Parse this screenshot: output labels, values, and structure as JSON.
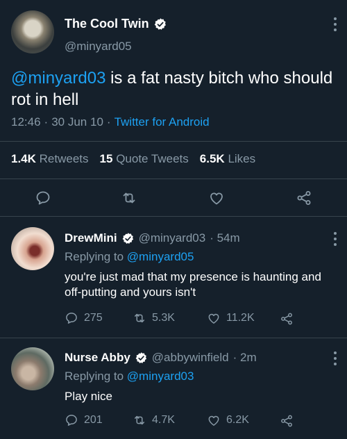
{
  "main_tweet": {
    "display_name": "The Cool Twin",
    "handle": "@minyard05",
    "mention": "@minyard03",
    "text": " is a fat nasty bitch who should rot in hell",
    "time": "12:46",
    "date": "30 Jun 10",
    "source": "Twitter for Android",
    "sep": "·",
    "stats": {
      "retweets_count": "1.4K",
      "retweets_label": "Retweets",
      "quotes_count": "15",
      "quotes_label": "Quote Tweets",
      "likes_count": "6.5K",
      "likes_label": "Likes"
    }
  },
  "replies": [
    {
      "display_name": "DrewMini",
      "handle": "@minyard03",
      "time": "· 54m",
      "replying_label": "Replying to",
      "replying_to": "@minyard05",
      "text": "you're just mad that my presence is haunting and off-putting and yours isn't",
      "replies_count": "275",
      "retweets_count": "5.3K",
      "likes_count": "11.2K"
    },
    {
      "display_name": "Nurse Abby",
      "handle": "@abbywinfield",
      "time": "· 2m",
      "replying_label": "Replying to",
      "replying_to": "@minyard03",
      "text": "Play nice",
      "replies_count": "201",
      "retweets_count": "4.7K",
      "likes_count": "6.2K"
    }
  ],
  "colors": {
    "background": "#15202b",
    "accent": "#1da1f2",
    "muted": "#8899a6",
    "divider": "#38444d"
  },
  "icons": [
    "verified-icon",
    "more-icon",
    "reply-icon",
    "retweet-icon",
    "like-icon",
    "share-icon"
  ]
}
